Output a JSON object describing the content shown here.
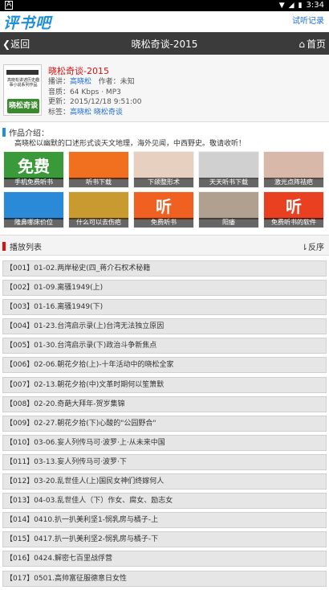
{
  "status_bar": {
    "time": "3:34",
    "left_icon": "A"
  },
  "brand": {
    "logo": "评书吧",
    "history_link": "试听记录"
  },
  "nav": {
    "back_label": "返回",
    "title": "晓松奇谈-2015",
    "home_label": "首页"
  },
  "album": {
    "cover_text": "高晓松讲述历史趣事小说系列作品",
    "cover_tag": "晓松奇谈",
    "name": "晓松奇谈-2015",
    "narrator_label": "播讲：",
    "narrator": "高晓松",
    "author_label": "作者：",
    "author": "未知",
    "quality_label": "音质：",
    "quality": "64 Kbps · MP3",
    "updated_label": "更新：",
    "updated": "2015/12/18 9:51:00",
    "tags_label": "标签：",
    "tags": "高晓松 晓松奇谈"
  },
  "intro": {
    "heading": "作品介绍：",
    "text": "高晓松以幽默的口述形式谈天文地理，海外见闻，中西野史。敬请收听！"
  },
  "ads": [
    {
      "label": "手机免费听书",
      "big": "免费",
      "color": "#3a9a3a"
    },
    {
      "label": "听书下载",
      "big": "",
      "color": "#f07020"
    },
    {
      "label": "下颌整形术",
      "big": "",
      "color": "#e8d0c0"
    },
    {
      "label": "天天听书下载",
      "big": "",
      "color": "#d0d0d0"
    },
    {
      "label": "激光点阵祛疤",
      "big": "",
      "color": "#d8b8a8"
    },
    {
      "label": "隆鼻哪床价位",
      "big": "",
      "color": "#2a8ad8"
    },
    {
      "label": "什么可以去伤疤",
      "big": "",
      "color": "#c89a30"
    },
    {
      "label": "免费听书",
      "big": "听",
      "color": "#f06020"
    },
    {
      "label": "阳痿",
      "big": "",
      "color": "#b0a090"
    },
    {
      "label": "免费听书的软件",
      "big": "听",
      "color": "#e84020"
    }
  ],
  "playlist": {
    "heading": "播放列表",
    "sort_label": "⇂反序",
    "items": [
      "【001】01-02.两岸秘史(四_蒋介石权术秘籍",
      "【002】01-09.离骚1949(上)",
      "【003】01-16.离骚1949(下)",
      "【004】01-23.台湾启示录(上)台湾无法独立原因",
      "【005】01-30.台湾启示录(下)政治斗争新焦点",
      "【006】02-06.朝花夕拾(上)-十年活动中的晓松全家",
      "【007】02-13.朝花夕拾(中)文革时期何以笙箫默",
      "【008】02-20.奇葩大拜年-贺岁集锦",
      "【009】02-27.朝花夕拾(下)心酸的\"公园野合\"",
      "【010】03-06.妄人列传马可·波罗·上·从未来中国",
      "【011】03-13.妄人列传马可·波罗·下",
      "【012】03-20.乱世佳人(上)国民女神们终嫁何人",
      "【013】04-03.乱世佳人（下）作女、腐女、励志女",
      "【014】0410.扒一扒美利坚1-悯乳房与橘子-上",
      "【015】0417.扒一扒美利坚2-悯乳房与橘子-下",
      "【016】0424.解密七百里战俘营",
      "【017】0501.高帅富征服德意日女性"
    ]
  }
}
